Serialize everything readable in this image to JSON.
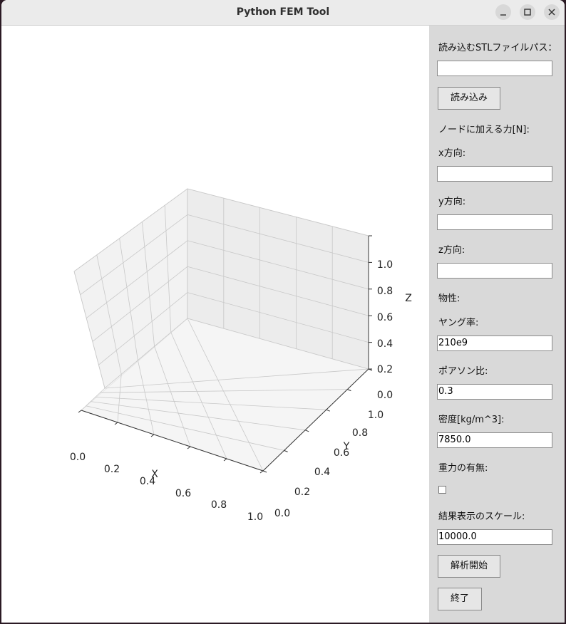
{
  "window": {
    "title": "Python FEM Tool"
  },
  "plot": {
    "x_label": "X",
    "y_label": "Y",
    "z_label": "Z",
    "x_ticks": [
      "0.0",
      "0.2",
      "0.4",
      "0.6",
      "0.8",
      "1.0"
    ],
    "y_ticks": [
      "0.0",
      "0.2",
      "0.4",
      "0.6",
      "0.8",
      "1.0"
    ],
    "z_ticks": [
      "0.0",
      "0.2",
      "0.4",
      "0.6",
      "0.8",
      "1.0"
    ]
  },
  "panel": {
    "stl_label": "読み込むSTLファイルパス：",
    "stl_value": "",
    "load_button": "読み込み",
    "force_label": "ノードに加える力[N]:",
    "fx_label": "x方向:",
    "fx_value": "",
    "fy_label": "y方向:",
    "fy_value": "",
    "fz_label": "z方向:",
    "fz_value": "",
    "material_label": "物性:",
    "young_label": "ヤング率:",
    "young_value": "210e9",
    "poisson_label": "ポアソン比:",
    "poisson_value": "0.3",
    "density_label": "密度[kg/m^3]:",
    "density_value": "7850.0",
    "gravity_label": "重力の有無:",
    "gravity_checked": false,
    "scale_label": "結果表示のスケール:",
    "scale_value": "10000.0",
    "run_button": "解析開始",
    "quit_button": "終了"
  }
}
